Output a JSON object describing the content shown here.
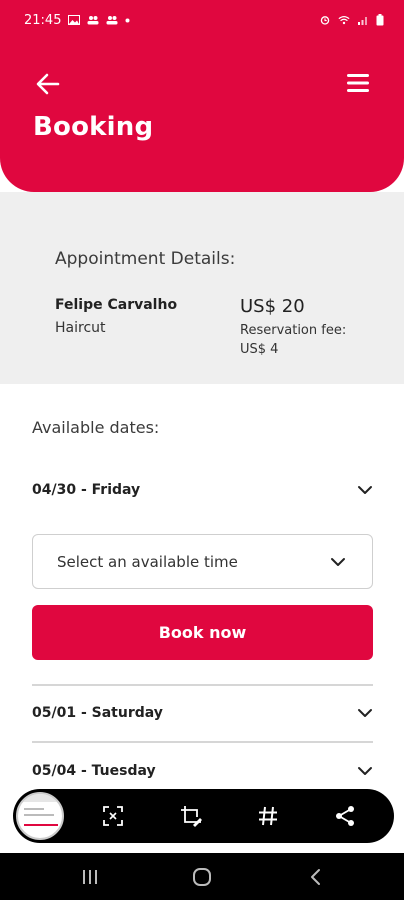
{
  "status_bar": {
    "time": "21:45",
    "left_icons": [
      "gallery-icon",
      "people-icon",
      "people-icon",
      "dot-icon"
    ],
    "right_icons": [
      "alarm-icon",
      "wifi-icon",
      "signal-icon",
      "battery-icon"
    ]
  },
  "header": {
    "title": "Booking",
    "back_icon": "arrow-left-icon",
    "menu_icon": "hamburger-menu-icon",
    "color": "#e0073f"
  },
  "appointment": {
    "heading": "Appointment Details:",
    "professional": "Felipe Carvalho",
    "service": "Haircut",
    "price": "US$ 20",
    "fee_label": "Reservation fee:",
    "fee_value": "US$ 4"
  },
  "dates": {
    "heading": "Available dates:",
    "items": [
      {
        "label": "04/30 - Friday"
      },
      {
        "label": "05/01 - Saturday"
      },
      {
        "label": "05/04 - Tuesday"
      }
    ],
    "time_select": {
      "placeholder": "Select an available time"
    },
    "book_button": "Book now"
  },
  "floating_toolbar": {
    "icons": [
      "screenshot-thumbnail",
      "scan-text-icon",
      "crop-edit-icon",
      "hashtag-icon",
      "share-icon"
    ]
  },
  "nav_bar": {
    "icons": [
      "recent-apps-icon",
      "home-icon",
      "back-icon"
    ]
  }
}
